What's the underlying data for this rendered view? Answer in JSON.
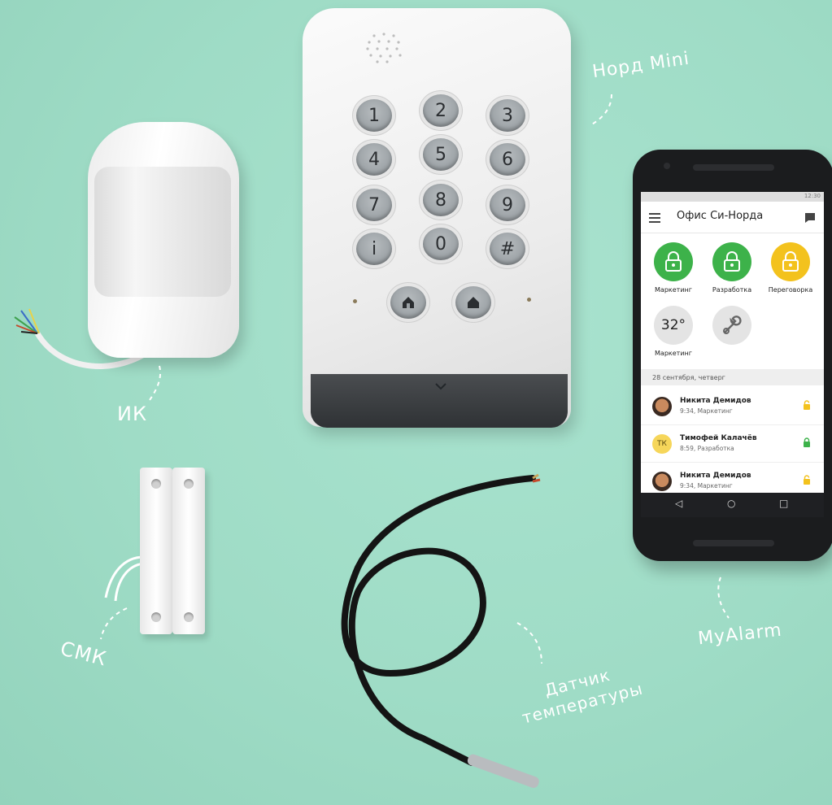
{
  "labels": {
    "keypad": "Норд Mini",
    "pir": "ИК",
    "contact": "СМК",
    "phone": "MyAlarm",
    "temperature": "Датчик температуры"
  },
  "keypad": {
    "keys": [
      "1",
      "2",
      "3",
      "4",
      "5",
      "6",
      "7",
      "8",
      "9",
      "i",
      "0",
      "#"
    ]
  },
  "phone": {
    "status_time": "12:30",
    "app_title": "Офис Си-Норда",
    "tiles": [
      {
        "label": "Маркетинг",
        "color": "#3db24a"
      },
      {
        "label": "Разработка",
        "color": "#3db24a"
      },
      {
        "label": "Переговорка",
        "color": "#f3c21d"
      }
    ],
    "temp_tile": {
      "value": "32°",
      "label": "Маркетинг"
    },
    "date_header": "28 сентября, четверг",
    "events": [
      {
        "name": "Никита Демидов",
        "sub": "9:34, Маркетинг",
        "lock_color": "#f3c21d",
        "initials": ""
      },
      {
        "name": "Тимофей Калачёв",
        "sub": "8:59, Разработка",
        "lock_color": "#3db24a",
        "initials": "ТК"
      },
      {
        "name": "Никита Демидов",
        "sub": "9:34, Маркетинг",
        "lock_color": "#f3c21d",
        "initials": ""
      }
    ]
  }
}
